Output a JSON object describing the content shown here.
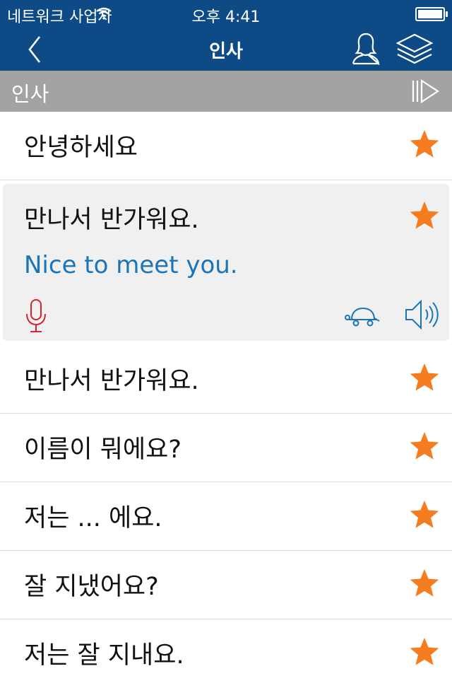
{
  "status_bar": {
    "carrier": "네트워크 사업자",
    "time": "오후 4:41"
  },
  "nav": {
    "title": "인사"
  },
  "section": {
    "title": "인사"
  },
  "first_row": {
    "text": "안녕하세요"
  },
  "expanded": {
    "korean": "만나서 반가워요.",
    "english": "Nice to meet you."
  },
  "rows": [
    {
      "text": "만나서 반가워요."
    },
    {
      "text": "이름이 뭐에요?"
    },
    {
      "text": "저는 ... 에요."
    },
    {
      "text": "잘 지냈어요?"
    },
    {
      "text": "저는 잘 지내요."
    }
  ],
  "colors": {
    "nav_bar": "#0e4a86",
    "section_header": "#a3a3a3",
    "star": "#f57c1f",
    "translation_text": "#1a75b8",
    "mic": "#d9232e",
    "expanded_background": "#f0f0f0"
  },
  "icons": [
    "wifi-icon",
    "battery-icon",
    "back-chevron-icon",
    "person-icon",
    "layers-icon",
    "play-all-icon",
    "star-icon",
    "microphone-icon",
    "turtle-icon",
    "speaker-icon"
  ]
}
